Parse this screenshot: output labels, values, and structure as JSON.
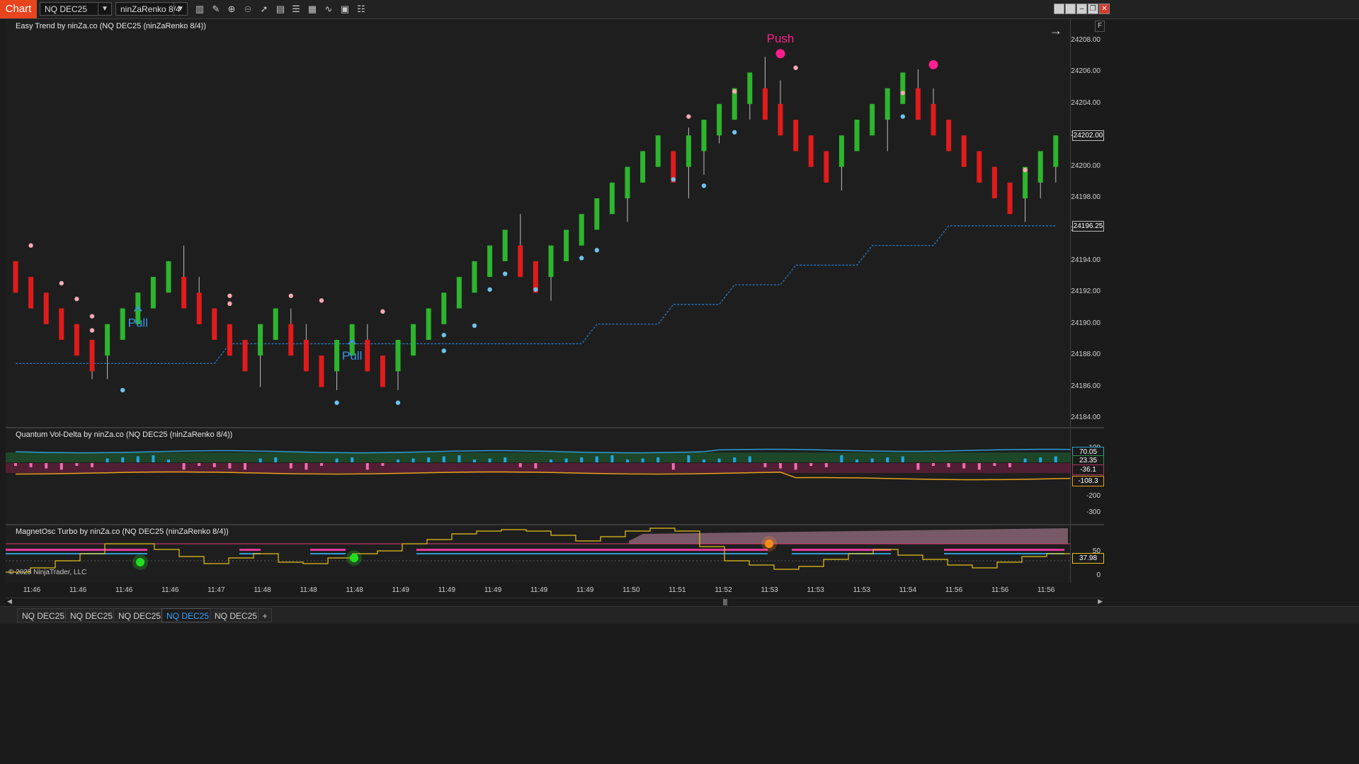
{
  "toolbar": {
    "chart_tag": "Chart",
    "instrument": "NQ DEC25",
    "bar_type": "ninZaRenko 8/4"
  },
  "panels": {
    "price": {
      "title": "Easy Trend by ninZa.co (NQ DEC25 (ninZaRenko 8/4))"
    },
    "voldelta": {
      "title": "Quantum Vol-Delta by ninZa.co (NQ DEC25 (ninZaRenko 8/4))"
    },
    "magnet": {
      "title": "MagnetOsc Turbo by ninZa.co (NQ DEC25 (ninZaRenko 8/4))"
    }
  },
  "price_axis": {
    "labels": [
      "24208.00",
      "24206.00",
      "24204.00",
      "24202.00",
      "24200.00",
      "24198.00",
      "24196.00",
      "24194.00",
      "24192.00",
      "24190.00",
      "24188.00",
      "24186.00",
      "24184.00"
    ],
    "last_price": "24202.00",
    "trend_level": "24196.25"
  },
  "voldelta_axis": {
    "labels": [
      "100",
      "-200",
      "-300"
    ],
    "markers": [
      "70.05",
      "23.35",
      "-36.1",
      "-108.3"
    ]
  },
  "magnet_axis": {
    "labels": [
      "50",
      "0"
    ],
    "marker": "37.98"
  },
  "annotations": {
    "pull": "Pull",
    "push": "Push"
  },
  "time_axis": [
    "11:46",
    "11:46",
    "11:46",
    "11:46",
    "11:47",
    "11:48",
    "11:48",
    "11:48",
    "11:49",
    "11:49",
    "11:49",
    "11:49",
    "11:49",
    "11:50",
    "11:51",
    "11:52",
    "11:53",
    "11:53",
    "11:53",
    "11:54",
    "11:56",
    "11:56",
    "11:56"
  ],
  "footer": {
    "copyright": "© 2025 NinjaTrader, LLC",
    "panel_flag": "F"
  },
  "tabs": [
    "NQ DEC25",
    "NQ DEC25",
    "NQ DEC25",
    "NQ DEC25",
    "NQ DEC25"
  ],
  "active_tab": 3,
  "add_tab": "+",
  "colors": {
    "up": "#2db52d",
    "down": "#e01b1b",
    "trend": "#2a7fd4",
    "dot_pink": "#f4a9b3",
    "dot_blue": "#6bc3ec",
    "push": "#ff1f8e",
    "pull": "#3a92ea"
  },
  "chart_data": {
    "type": "candlestick",
    "bars": [
      {
        "o": 24194.0,
        "c": 24192.0,
        "h": 24194.0,
        "l": 24192.0
      },
      {
        "o": 24193.0,
        "c": 24191.0,
        "h": 24193.0,
        "l": 24191.0
      },
      {
        "o": 24192.0,
        "c": 24190.0,
        "h": 24192.0,
        "l": 24190.0
      },
      {
        "o": 24191.0,
        "c": 24189.0,
        "h": 24191.0,
        "l": 24189.0
      },
      {
        "o": 24190.0,
        "c": 24188.0,
        "h": 24190.0,
        "l": 24188.0
      },
      {
        "o": 24189.0,
        "c": 24187.0,
        "h": 24189.0,
        "l": 24186.5
      },
      {
        "o": 24188.0,
        "c": 24190.0,
        "h": 24190.0,
        "l": 24186.5
      },
      {
        "o": 24189.0,
        "c": 24191.0,
        "h": 24191.0,
        "l": 24189.0
      },
      {
        "o": 24190.0,
        "c": 24192.0,
        "h": 24192.0,
        "l": 24190.0
      },
      {
        "o": 24191.0,
        "c": 24193.0,
        "h": 24193.0,
        "l": 24191.0
      },
      {
        "o": 24192.0,
        "c": 24194.0,
        "h": 24194.0,
        "l": 24192.0
      },
      {
        "o": 24193.0,
        "c": 24191.0,
        "h": 24195.0,
        "l": 24191.0
      },
      {
        "o": 24192.0,
        "c": 24190.0,
        "h": 24193.0,
        "l": 24190.0
      },
      {
        "o": 24191.0,
        "c": 24189.0,
        "h": 24191.0,
        "l": 24189.0
      },
      {
        "o": 24190.0,
        "c": 24188.0,
        "h": 24190.0,
        "l": 24188.0
      },
      {
        "o": 24189.0,
        "c": 24187.0,
        "h": 24189.0,
        "l": 24187.0
      },
      {
        "o": 24188.0,
        "c": 24190.0,
        "h": 24190.0,
        "l": 24186.0
      },
      {
        "o": 24189.0,
        "c": 24191.0,
        "h": 24191.0,
        "l": 24189.0
      },
      {
        "o": 24190.0,
        "c": 24188.0,
        "h": 24191.0,
        "l": 24188.0
      },
      {
        "o": 24189.0,
        "c": 24187.0,
        "h": 24190.0,
        "l": 24187.0
      },
      {
        "o": 24188.0,
        "c": 24186.0,
        "h": 24188.0,
        "l": 24186.0
      },
      {
        "o": 24187.0,
        "c": 24189.0,
        "h": 24189.0,
        "l": 24185.8
      },
      {
        "o": 24188.0,
        "c": 24190.0,
        "h": 24190.0,
        "l": 24188.0
      },
      {
        "o": 24189.0,
        "c": 24187.0,
        "h": 24190.0,
        "l": 24187.0
      },
      {
        "o": 24188.0,
        "c": 24186.0,
        "h": 24188.0,
        "l": 24186.0
      },
      {
        "o": 24187.0,
        "c": 24189.0,
        "h": 24189.0,
        "l": 24185.8
      },
      {
        "o": 24188.0,
        "c": 24190.0,
        "h": 24190.0,
        "l": 24188.0
      },
      {
        "o": 24189.0,
        "c": 24191.0,
        "h": 24191.0,
        "l": 24189.0
      },
      {
        "o": 24190.0,
        "c": 24192.0,
        "h": 24192.0,
        "l": 24190.0
      },
      {
        "o": 24191.0,
        "c": 24193.0,
        "h": 24193.0,
        "l": 24191.0
      },
      {
        "o": 24192.0,
        "c": 24194.0,
        "h": 24194.0,
        "l": 24192.0
      },
      {
        "o": 24193.0,
        "c": 24195.0,
        "h": 24195.0,
        "l": 24193.0
      },
      {
        "o": 24194.0,
        "c": 24196.0,
        "h": 24196.0,
        "l": 24194.0
      },
      {
        "o": 24195.0,
        "c": 24193.0,
        "h": 24197.0,
        "l": 24193.0
      },
      {
        "o": 24194.0,
        "c": 24192.0,
        "h": 24194.0,
        "l": 24192.0
      },
      {
        "o": 24193.0,
        "c": 24195.0,
        "h": 24195.0,
        "l": 24191.5
      },
      {
        "o": 24194.0,
        "c": 24196.0,
        "h": 24196.0,
        "l": 24194.0
      },
      {
        "o": 24195.0,
        "c": 24197.0,
        "h": 24197.0,
        "l": 24195.0
      },
      {
        "o": 24196.0,
        "c": 24198.0,
        "h": 24198.0,
        "l": 24196.0
      },
      {
        "o": 24197.0,
        "c": 24199.0,
        "h": 24199.0,
        "l": 24197.0
      },
      {
        "o": 24198.0,
        "c": 24200.0,
        "h": 24200.0,
        "l": 24196.5
      },
      {
        "o": 24199.0,
        "c": 24201.0,
        "h": 24201.0,
        "l": 24199.0
      },
      {
        "o": 24200.0,
        "c": 24202.0,
        "h": 24202.0,
        "l": 24200.0
      },
      {
        "o": 24201.0,
        "c": 24199.0,
        "h": 24201.0,
        "l": 24199.0
      },
      {
        "o": 24200.0,
        "c": 24202.0,
        "h": 24202.5,
        "l": 24198.0
      },
      {
        "o": 24201.0,
        "c": 24203.0,
        "h": 24203.0,
        "l": 24199.5
      },
      {
        "o": 24202.0,
        "c": 24204.0,
        "h": 24204.0,
        "l": 24201.5
      },
      {
        "o": 24203.0,
        "c": 24205.0,
        "h": 24205.0,
        "l": 24203.0
      },
      {
        "o": 24204.0,
        "c": 24206.0,
        "h": 24206.0,
        "l": 24203.0
      },
      {
        "o": 24205.0,
        "c": 24203.0,
        "h": 24207.0,
        "l": 24203.0
      },
      {
        "o": 24204.0,
        "c": 24202.0,
        "h": 24205.5,
        "l": 24202.0
      },
      {
        "o": 24203.0,
        "c": 24201.0,
        "h": 24203.0,
        "l": 24201.0
      },
      {
        "o": 24202.0,
        "c": 24200.0,
        "h": 24202.0,
        "l": 24200.0
      },
      {
        "o": 24201.0,
        "c": 24199.0,
        "h": 24201.0,
        "l": 24199.0
      },
      {
        "o": 24200.0,
        "c": 24202.0,
        "h": 24202.0,
        "l": 24198.5
      },
      {
        "o": 24201.0,
        "c": 24203.0,
        "h": 24203.0,
        "l": 24201.0
      },
      {
        "o": 24202.0,
        "c": 24204.0,
        "h": 24204.0,
        "l": 24202.0
      },
      {
        "o": 24203.0,
        "c": 24205.0,
        "h": 24205.0,
        "l": 24201.0
      },
      {
        "o": 24204.0,
        "c": 24206.0,
        "h": 24206.0,
        "l": 24204.0
      },
      {
        "o": 24205.0,
        "c": 24203.0,
        "h": 24206.2,
        "l": 24203.0
      },
      {
        "o": 24204.0,
        "c": 24202.0,
        "h": 24205.0,
        "l": 24202.0
      },
      {
        "o": 24203.0,
        "c": 24201.0,
        "h": 24203.0,
        "l": 24201.0
      },
      {
        "o": 24202.0,
        "c": 24200.0,
        "h": 24202.0,
        "l": 24200.0
      },
      {
        "o": 24201.0,
        "c": 24199.0,
        "h": 24201.0,
        "l": 24199.0
      },
      {
        "o": 24200.0,
        "c": 24198.0,
        "h": 24200.0,
        "l": 24198.0
      },
      {
        "o": 24199.0,
        "c": 24197.0,
        "h": 24199.0,
        "l": 24197.0
      },
      {
        "o": 24198.0,
        "c": 24200.0,
        "h": 24200.0,
        "l": 24196.5
      },
      {
        "o": 24199.0,
        "c": 24201.0,
        "h": 24201.0,
        "l": 24198.0
      },
      {
        "o": 24200.0,
        "c": 24202.0,
        "h": 24202.0,
        "l": 24199.0
      }
    ],
    "trend_line": [
      {
        "i": 0,
        "v": 24187.5
      },
      {
        "i": 13,
        "v": 24187.5
      },
      {
        "i": 14,
        "v": 24188.75
      },
      {
        "i": 37,
        "v": 24188.75
      },
      {
        "i": 38,
        "v": 24190.0
      },
      {
        "i": 42,
        "v": 24190.0
      },
      {
        "i": 43,
        "v": 24191.25
      },
      {
        "i": 46,
        "v": 24191.25
      },
      {
        "i": 47,
        "v": 24192.5
      },
      {
        "i": 50,
        "v": 24192.5
      },
      {
        "i": 51,
        "v": 24193.75
      },
      {
        "i": 55,
        "v": 24193.75
      },
      {
        "i": 56,
        "v": 24195.0
      },
      {
        "i": 60,
        "v": 24195.0
      },
      {
        "i": 61,
        "v": 24196.25
      },
      {
        "i": 68,
        "v": 24196.25
      }
    ],
    "dots": [
      {
        "i": 1,
        "v": 24195.0,
        "c": "pink"
      },
      {
        "i": 3,
        "v": 24192.6,
        "c": "pink"
      },
      {
        "i": 4,
        "v": 24191.6,
        "c": "pink"
      },
      {
        "i": 5,
        "v": 24190.5,
        "c": "pink"
      },
      {
        "i": 5,
        "v": 24189.6,
        "c": "pink"
      },
      {
        "i": 7,
        "v": 24185.8,
        "c": "blue"
      },
      {
        "i": 14,
        "v": 24191.8,
        "c": "pink"
      },
      {
        "i": 14,
        "v": 24191.3,
        "c": "pink"
      },
      {
        "i": 18,
        "v": 24191.8,
        "c": "pink"
      },
      {
        "i": 20,
        "v": 24191.5,
        "c": "pink"
      },
      {
        "i": 21,
        "v": 24185.0,
        "c": "blue"
      },
      {
        "i": 24,
        "v": 24190.8,
        "c": "pink"
      },
      {
        "i": 25,
        "v": 24185.0,
        "c": "blue"
      },
      {
        "i": 28,
        "v": 24189.3,
        "c": "blue"
      },
      {
        "i": 28,
        "v": 24188.3,
        "c": "blue"
      },
      {
        "i": 30,
        "v": 24189.9,
        "c": "blue"
      },
      {
        "i": 31,
        "v": 24192.2,
        "c": "blue"
      },
      {
        "i": 32,
        "v": 24193.2,
        "c": "blue"
      },
      {
        "i": 34,
        "v": 24192.2,
        "c": "blue"
      },
      {
        "i": 37,
        "v": 24194.2,
        "c": "blue"
      },
      {
        "i": 38,
        "v": 24194.7,
        "c": "blue"
      },
      {
        "i": 43,
        "v": 24199.2,
        "c": "blue"
      },
      {
        "i": 44,
        "v": 24203.2,
        "c": "pink"
      },
      {
        "i": 45,
        "v": 24198.8,
        "c": "blue"
      },
      {
        "i": 47,
        "v": 24202.2,
        "c": "blue"
      },
      {
        "i": 47,
        "v": 24204.8,
        "c": "pink"
      },
      {
        "i": 51,
        "v": 24206.3,
        "c": "pink"
      },
      {
        "i": 58,
        "v": 24204.7,
        "c": "pink"
      },
      {
        "i": 58,
        "v": 24203.2,
        "c": "blue"
      },
      {
        "i": 66,
        "v": 24199.8,
        "c": "pink"
      }
    ],
    "pull_signals": [
      {
        "i": 8,
        "v": 24191.0
      },
      {
        "i": 22,
        "v": 24188.9
      }
    ],
    "push_signals": [
      {
        "i": 50,
        "v": 24207.2
      },
      {
        "i": 60,
        "v": 24206.5
      }
    ]
  }
}
